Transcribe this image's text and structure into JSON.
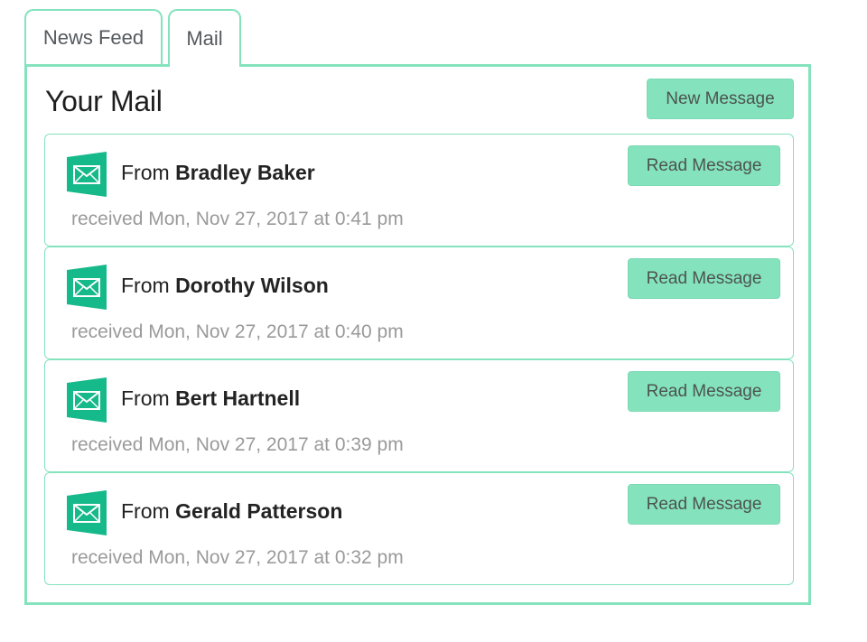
{
  "tabs": [
    {
      "label": "News Feed"
    },
    {
      "label": "Mail"
    }
  ],
  "panel": {
    "title": "Your Mail",
    "new_message_label": "New Message"
  },
  "colors": {
    "accent": "#84e3bd",
    "icon": "#16b98a"
  },
  "messages": [
    {
      "prefix": "From",
      "sender": "Bradley Baker",
      "received": "received Mon, Nov 27, 2017 at 0:41 pm",
      "action": "Read Message",
      "icon": "envelope-icon"
    },
    {
      "prefix": "From",
      "sender": "Dorothy Wilson",
      "received": "received Mon, Nov 27, 2017 at 0:40 pm",
      "action": "Read Message",
      "icon": "envelope-icon"
    },
    {
      "prefix": "From",
      "sender": "Bert Hartnell",
      "received": "received Mon, Nov 27, 2017 at 0:39 pm",
      "action": "Read Message",
      "icon": "envelope-icon"
    },
    {
      "prefix": "From",
      "sender": "Gerald Patterson",
      "received": "received Mon, Nov 27, 2017 at 0:32 pm",
      "action": "Read Message",
      "icon": "envelope-icon"
    }
  ]
}
